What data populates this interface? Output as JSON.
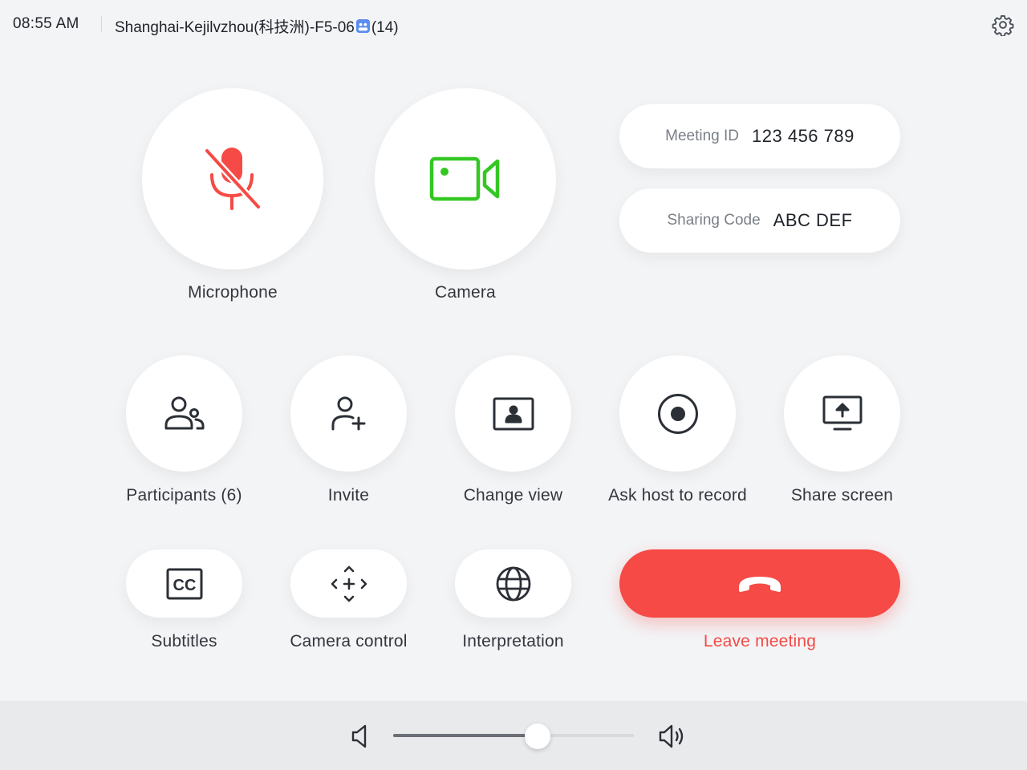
{
  "header": {
    "time": "08:55 AM",
    "room_name": "Shanghai-Kejilvzhou(科技洲)-F5-06",
    "room_capacity": "(14)",
    "settings_icon": "gear-icon"
  },
  "main_controls": {
    "microphone": {
      "label": "Microphone",
      "state": "muted",
      "icon": "microphone-off-icon",
      "color": "#f54a45"
    },
    "camera": {
      "label": "Camera",
      "state": "on",
      "icon": "video-camera-icon",
      "color": "#34c724"
    }
  },
  "meeting_info": {
    "meeting_id_label": "Meeting ID",
    "meeting_id_value": "123 456 789",
    "sharing_code_label": "Sharing Code",
    "sharing_code_value": "ABC DEF"
  },
  "actions_row1": [
    {
      "label": "Participants (6)",
      "icon": "participants-icon"
    },
    {
      "label": "Invite",
      "icon": "add-person-icon"
    },
    {
      "label": "Change view",
      "icon": "change-view-icon"
    },
    {
      "label": "Ask host to record",
      "icon": "record-icon"
    },
    {
      "label": "Share screen",
      "icon": "share-screen-icon"
    }
  ],
  "actions_row2": [
    {
      "label": "Subtitles",
      "icon": "closed-caption-icon"
    },
    {
      "label": "Camera control",
      "icon": "camera-control-icon"
    },
    {
      "label": "Interpretation",
      "icon": "globe-icon"
    }
  ],
  "leave": {
    "label": "Leave meeting",
    "icon": "hang-up-icon",
    "color": "#f54a45"
  },
  "volume": {
    "level": 0.6,
    "low_icon": "volume-low-icon",
    "high_icon": "volume-high-icon"
  }
}
